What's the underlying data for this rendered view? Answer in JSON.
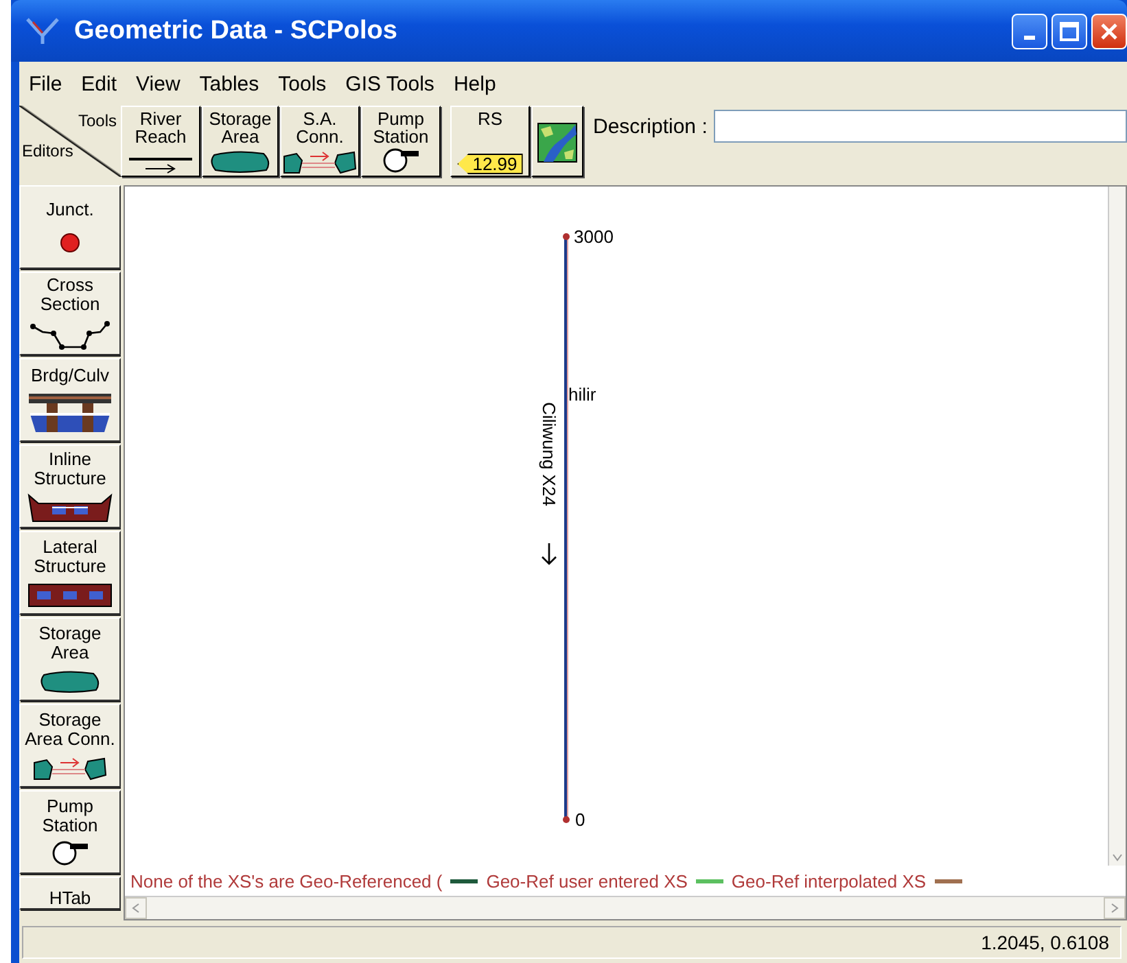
{
  "window": {
    "title": "Geometric Data - SCPolos"
  },
  "menu": [
    "File",
    "Edit",
    "View",
    "Tables",
    "Tools",
    "GIS Tools",
    "Help"
  ],
  "toolbar": {
    "corner": {
      "top": "Tools",
      "bottom": "Editors"
    },
    "tools": [
      {
        "kind": "river_reach",
        "label": "River\nReach"
      },
      {
        "kind": "storage_area",
        "label": "Storage\nArea"
      },
      {
        "kind": "sa_conn",
        "label": "S.A.\nConn."
      },
      {
        "kind": "pump",
        "label": "Pump\nStation"
      },
      {
        "kind": "rs",
        "label": "RS",
        "tag": "12.99"
      },
      {
        "kind": "map"
      }
    ],
    "description": {
      "label": "Description :"
    }
  },
  "editors": [
    {
      "kind": "junction",
      "label": "Junct."
    },
    {
      "kind": "cross_section",
      "label": "Cross\nSection"
    },
    {
      "kind": "bridge",
      "label": "Brdg/Culv"
    },
    {
      "kind": "inline",
      "label": "Inline\nStructure"
    },
    {
      "kind": "lateral",
      "label": "Lateral\nStructure"
    },
    {
      "kind": "storage_area",
      "label": "Storage\nArea"
    },
    {
      "kind": "sa_conn",
      "label": "Storage\nArea Conn."
    },
    {
      "kind": "pump",
      "label": "Pump\nStation"
    },
    {
      "kind": "htab",
      "label": "HTab"
    }
  ],
  "canvas": {
    "reach": {
      "river": "Ciliwung X24",
      "reach": "hilir",
      "top_station": "3000",
      "bottom_station": "0"
    },
    "legend": {
      "note": "None of the XS's are Geo-Referenced (",
      "items": [
        {
          "label": "Geo-Ref user entered XS",
          "color": "#1e5a3c"
        },
        {
          "label": "Geo-Ref interpolated XS",
          "color": "#5cc060"
        },
        {
          "color": "#a07050"
        }
      ]
    }
  },
  "status_bar": {
    "coordinates": "1.2045, 0.6108"
  }
}
